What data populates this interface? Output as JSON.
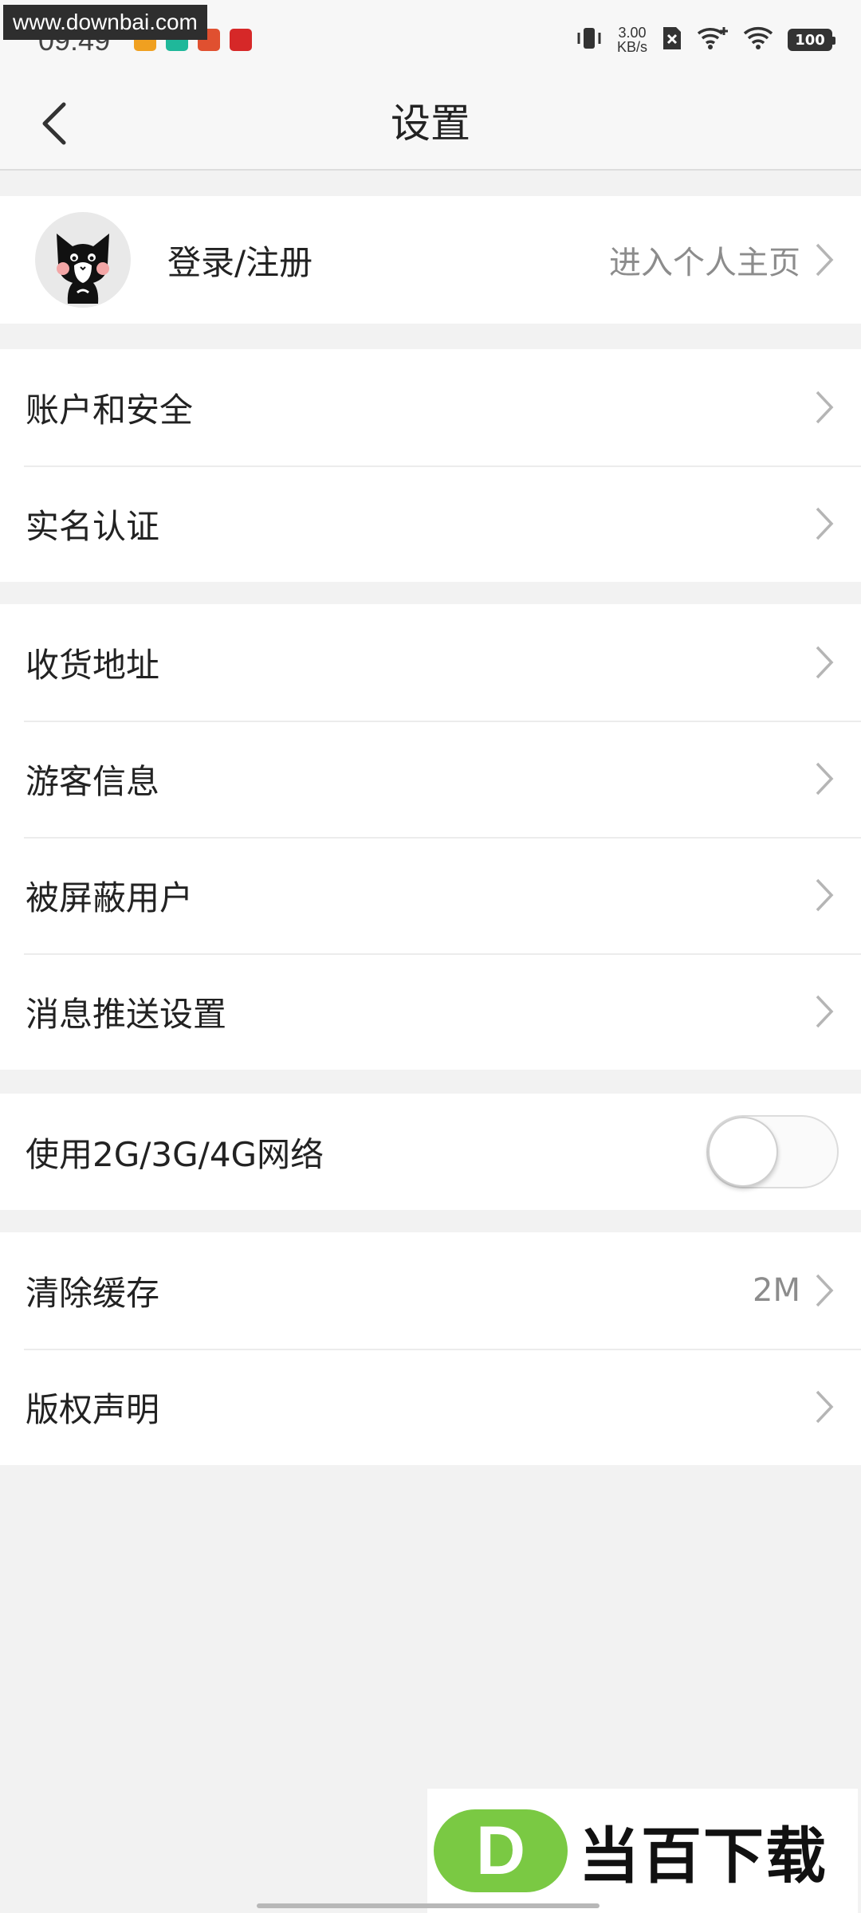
{
  "status_bar": {
    "watermark": "www.downbai.com",
    "time": "09:49",
    "speed_value": "3.00",
    "speed_unit": "KB/s",
    "battery": "100"
  },
  "header": {
    "title": "设置"
  },
  "profile": {
    "name": "登录/注册",
    "link": "进入个人主页"
  },
  "sections": {
    "account": [
      "账户和安全",
      "实名认证"
    ],
    "info": [
      "收货地址",
      "游客信息",
      "被屏蔽用户",
      "消息推送设置"
    ],
    "network": {
      "label": "使用2G/3G/4G网络",
      "enabled": false
    },
    "misc": [
      {
        "label": "清除缓存",
        "value": "2M"
      },
      {
        "label": "版权声明",
        "value": ""
      }
    ]
  },
  "footer_watermark": {
    "logo_letter": "D",
    "text": "当百下载"
  },
  "colors": {
    "background": "#f2f2f2",
    "card": "#ffffff",
    "secondary_text": "#8c8c8c",
    "brand_green": "#7ac943"
  }
}
